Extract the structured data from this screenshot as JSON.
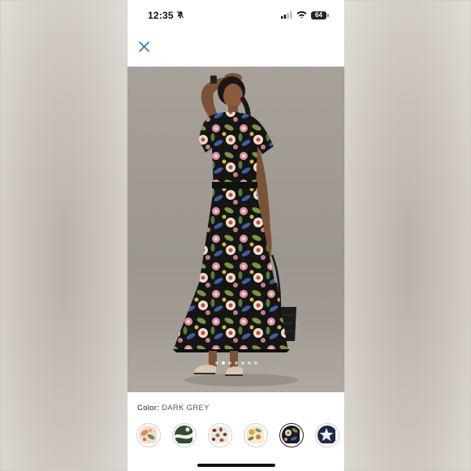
{
  "status_bar": {
    "time": "12:35",
    "battery_level": "64",
    "icons": [
      "bell-slash-icon",
      "cellular-signal-icon",
      "wifi-icon",
      "battery-icon"
    ]
  },
  "header": {
    "close_icon": "close-icon"
  },
  "gallery": {
    "image_count": 7,
    "active_index": 1
  },
  "color_selector": {
    "label": "Color:",
    "value": "DARK GREY",
    "swatches": [
      {
        "name": "peach-floral",
        "selected": false
      },
      {
        "name": "green-abstract",
        "selected": false
      },
      {
        "name": "brown-leopard",
        "selected": false
      },
      {
        "name": "yellow-floral",
        "selected": false
      },
      {
        "name": "dark-grey-floral",
        "selected": true
      },
      {
        "name": "navy-star",
        "selected": false
      }
    ]
  },
  "colors": {
    "accent": "#2f7bc0",
    "text": "#222222",
    "muted": "#555555"
  }
}
